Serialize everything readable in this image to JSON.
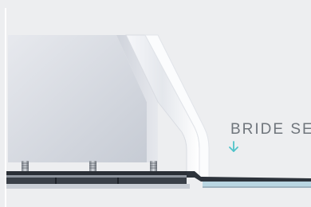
{
  "section": {
    "label": "BRIDE SEI",
    "arrow_icon": "arrow-down-icon",
    "accent_color": "#4fc3c9"
  },
  "colors": {
    "background": "#edeef0",
    "label_text": "#6f757c"
  }
}
